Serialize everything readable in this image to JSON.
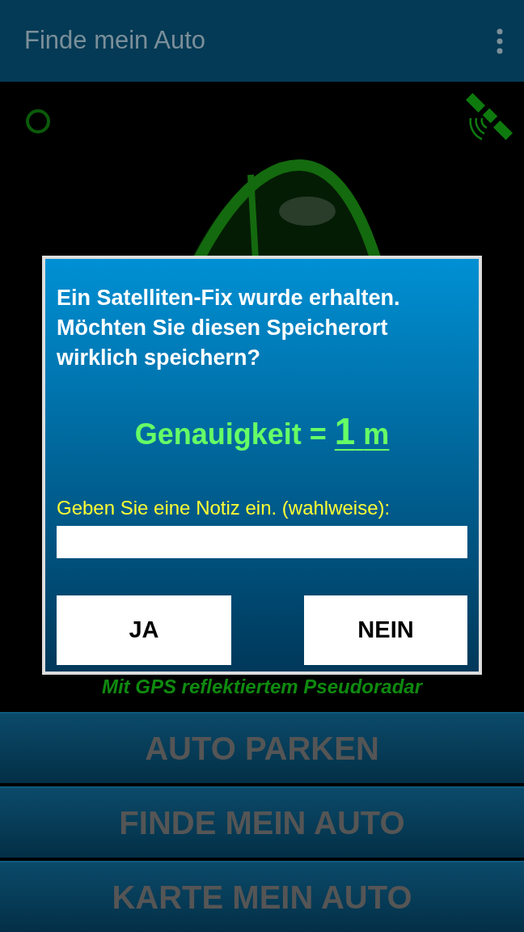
{
  "app_bar": {
    "title": "Finde mein Auto"
  },
  "radar": {
    "caption": "Mit GPS reflektiertem Pseudoradar"
  },
  "dialog": {
    "message": "Ein Satelliten-Fix wurde erhalten. Möchten Sie diesen Speicherort wirklich speichern?",
    "accuracy": {
      "label": "Genauigkeit =",
      "value": "1",
      "unit": "m"
    },
    "note": {
      "label": "Geben Sie eine Notiz ein. (wahlweise):"
    },
    "buttons": [
      "JA",
      "NEIN"
    ]
  },
  "actions": [
    "AUTO PARKEN",
    "FINDE MEIN AUTO",
    "KARTE MEIN AUTO"
  ]
}
